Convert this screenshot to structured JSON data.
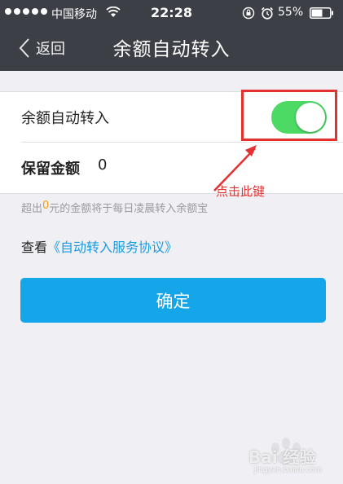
{
  "status_bar": {
    "carrier": "中国移动",
    "time": "22:28",
    "battery": "55%",
    "icons": [
      "signal-dots-icon",
      "wifi-icon",
      "rotation-lock-icon",
      "alarm-icon",
      "battery-icon"
    ]
  },
  "nav": {
    "back_label": "返回",
    "title": "余额自动转入"
  },
  "settings": {
    "auto_transfer": {
      "label": "余额自动转入",
      "enabled": true
    },
    "reserve": {
      "label": "保留金额",
      "value": "0"
    }
  },
  "hint": {
    "prefix": "超出",
    "amount": "0",
    "suffix": "元的金额将于每日凌晨转入余额宝"
  },
  "agreement": {
    "prefix": "查看",
    "link": "《自动转入服务协议》"
  },
  "confirm_label": "确定",
  "annotation": {
    "text": "点击此键"
  },
  "watermark": {
    "text": "Bai 经验",
    "url": "jingyan.baidu.com"
  },
  "colors": {
    "header_bg": "#3c3f46",
    "toggle_on": "#4cd964",
    "accent_blue": "#14a6e8",
    "link_blue": "#1a9ce3",
    "hint_amount": "#f39c12",
    "annotation_red": "#e53030"
  }
}
